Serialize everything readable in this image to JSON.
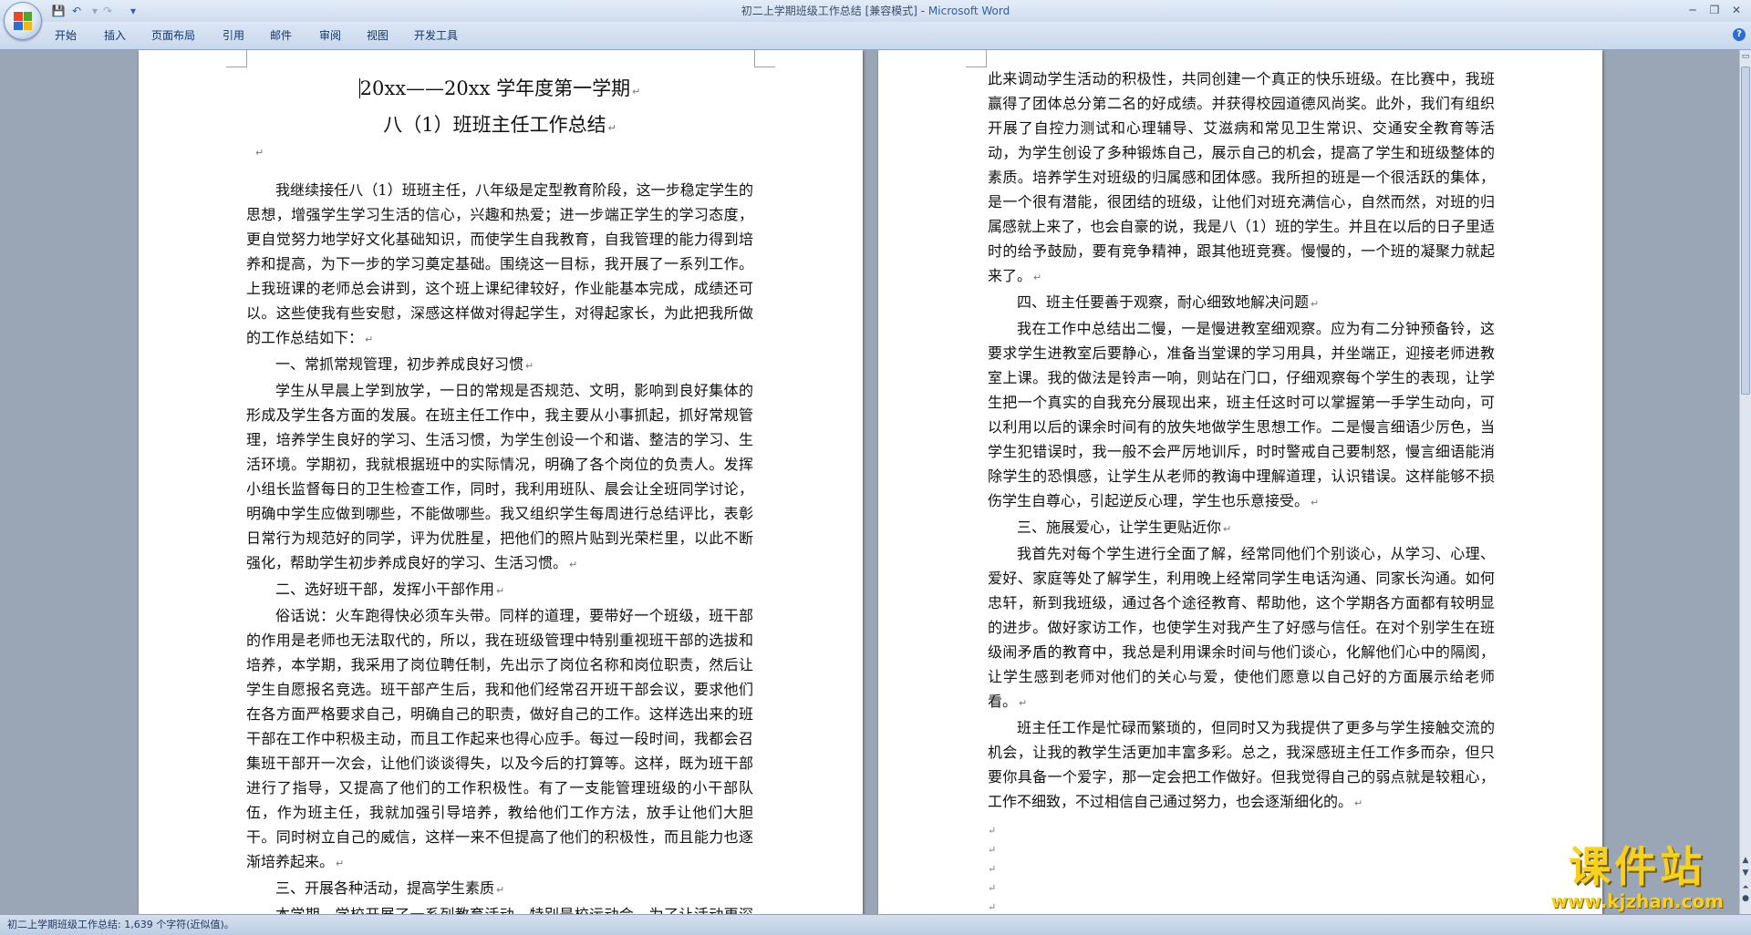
{
  "window": {
    "title": "初二上学期班级工作总结 [兼容模式] - ",
    "app_name": "Microsoft Word"
  },
  "quick_access": {
    "save_icon": "save-icon",
    "undo_icon": "undo-icon",
    "redo_icon": "redo-icon",
    "customize_icon": "dropdown-icon"
  },
  "ribbon": {
    "tabs": [
      "开始",
      "插入",
      "页面布局",
      "引用",
      "邮件",
      "审阅",
      "视图",
      "开发工具"
    ]
  },
  "document": {
    "title_line1": "20xx——20xx 学年度第一学期",
    "title_line2": "八（1）班班主任工作总结",
    "left_paragraphs": [
      {
        "type": "para",
        "text": "我继续接任八（1）班班主任，八年级是定型教育阶段，这一步稳定学生的思想，增强学生学习生活的信心，兴趣和热爱；进一步端正学生的学习态度，更自觉努力地学好文化基础知识，而使学生自我教育，自我管理的能力得到培养和提高，为下一步的学习奠定基础。围绕这一目标，我开展了一系列工作。上我班课的老师总会讲到，这个班上课纪律较好，作业能基本完成，成绩还可以。这些使我有些安慰，深感这样做对得起学生，对得起家长，为此把我所做的工作总结如下："
      },
      {
        "type": "heading",
        "text": "一、常抓常规管理，初步养成良好习惯"
      },
      {
        "type": "para",
        "text": "学生从早晨上学到放学，一日的常规是否规范、文明，影响到良好集体的形成及学生各方面的发展。在班主任工作中，我主要从小事抓起，抓好常规管理，培养学生良好的学习、生活习惯，为学生创设一个和谐、整洁的学习、生活环境。学期初，我就根据班中的实际情况，明确了各个岗位的负责人。发挥小组长监督每日的卫生检查工作，同时，我利用班队、晨会让全班同学讨论，明确中学生应做到哪些，不能做哪些。我又组织学生每周进行总结评比，表彰日常行为规范好的同学，评为优胜星，把他们的照片贴到光荣栏里，以此不断强化，帮助学生初步养成良好的学习、生活习惯。"
      },
      {
        "type": "heading",
        "text": "二、选好班干部，发挥小干部作用"
      },
      {
        "type": "para",
        "text": "俗话说：火车跑得快必须车头带。同样的道理，要带好一个班级，班干部的作用是老师也无法取代的，所以，我在班级管理中特别重视班干部的选拔和培养，本学期，我采用了岗位聘任制，先出示了岗位名称和岗位职责，然后让学生自愿报名竞选。班干部产生后，我和他们经常召开班干部会议，要求他们在各方面严格要求自己，明确自己的职责，做好自己的工作。这样选出来的班干部在工作中积极主动，而且工作起来也得心应手。每过一段时间，我都会召集班干部开一次会，让他们谈谈得失，以及今后的打算等。这样，既为班干部进行了指导，又提高了他们的工作积极性。有了一支能管理班级的小干部队伍，作为班主任，我就加强引导培养，教给他们工作方法，放手让他们大胆干。同时树立自己的威信，这样一来不但提高了他们的积极性，而且能力也逐渐培养起来。"
      },
      {
        "type": "heading",
        "text": "三、开展各种活动，提高学生素质"
      },
      {
        "type": "para",
        "text": "本学期，学校开展了一系列教育活动，特别是校运动会，为了让活动更深入、更具体、更全面，我鼓励学生人人参与，互相合作，竞技和友谊活动相结合，以"
      }
    ],
    "right_paragraphs": [
      {
        "type": "cont",
        "text": "此来调动学生活动的积极性，共同创建一个真正的快乐班级。在比赛中，我班赢得了团体总分第二名的好成绩。并获得校园道德风尚奖。此外，我们有组织开展了自控力测试和心理辅导、艾滋病和常见卫生常识、交通安全教育等活动，为学生创设了多种锻炼自己，展示自己的机会，提高了学生和班级整体的素质。培养学生对班级的归属感和团体感。我所担的班是一个很活跃的集体，是一个很有潜能，很团结的班级，让他们对班充满信心，自然而然，对班的归属感就上来了，也会自豪的说，我是八（1）班的学生。并且在以后的日子里适时的给予鼓励，要有竞争精神，跟其他班竞赛。慢慢的，一个班的凝聚力就起来了。"
      },
      {
        "type": "heading",
        "text": "四、班主任要善于观察，耐心细致地解决问题"
      },
      {
        "type": "para",
        "text": "我在工作中总结出二慢，一是慢进教室细观察。应为有二分钟预备铃，这要求学生进教室后要静心，准备当堂课的学习用具，并坐端正，迎接老师进教室上课。我的做法是铃声一响，则站在门口，仔细观察每个学生的表现，让学生把一个真实的自我充分展现出来，班主任这时可以掌握第一手学生动向，可以利用以后的课余时间有的放失地做学生思想工作。二是慢言细语少厉色，当学生犯错误时，我一般不会严厉地训斥，时时警戒自己要制怒，慢言细语能消除学生的恐惧感，让学生从老师的教诲中理解道理，认识错误。这样能够不损伤学生自尊心，引起逆反心理，学生也乐意接受。"
      },
      {
        "type": "heading",
        "text": "三、施展爱心，让学生更贴近你"
      },
      {
        "type": "para",
        "text": "我首先对每个学生进行全面了解，经常同他们个别谈心，从学习、心理、爱好、家庭等处了解学生，利用晚上经常同学生电话沟通、同家长沟通。如何忠轩，新到我班级，通过各个途径教育、帮助他，这个学期各方面都有较明显的进步。做好家访工作，也使学生对我产生了好感与信任。在对个别学生在班级闹矛盾的教育中，我总是利用课余时间与他们谈心，化解他们心中的隔阂，让学生感到老师对他们的关心与爱，使他们愿意以自己好的方面展示给老师看。"
      },
      {
        "type": "para",
        "text": "班主任工作是忙碌而繁琐的，但同时又为我提供了更多与学生接触交流的机会，让我的教学生活更加丰富多彩。总之，我深感班主任工作多而杂，但只要你具备一个爱字，那一定会把工作做好。但我觉得自己的弱点就是较粗心，工作不细致，不过相信自己通过努力，也会逐渐细化的。"
      }
    ],
    "paragraph_mark": "↵",
    "empty_paragraph_count": 8
  },
  "statusbar": {
    "text": "初二上学期班级工作总结: 1,639 个字符(近似值)。"
  },
  "watermark": {
    "text": "课件站",
    "url": "www.kjzhan.com"
  },
  "colors": {
    "ribbon_bg": "#c8d8ec",
    "app_name_blue": "#2d5fa8",
    "doc_bg": "#9aa6b5",
    "watermark_yellow": "#f7d21a"
  }
}
